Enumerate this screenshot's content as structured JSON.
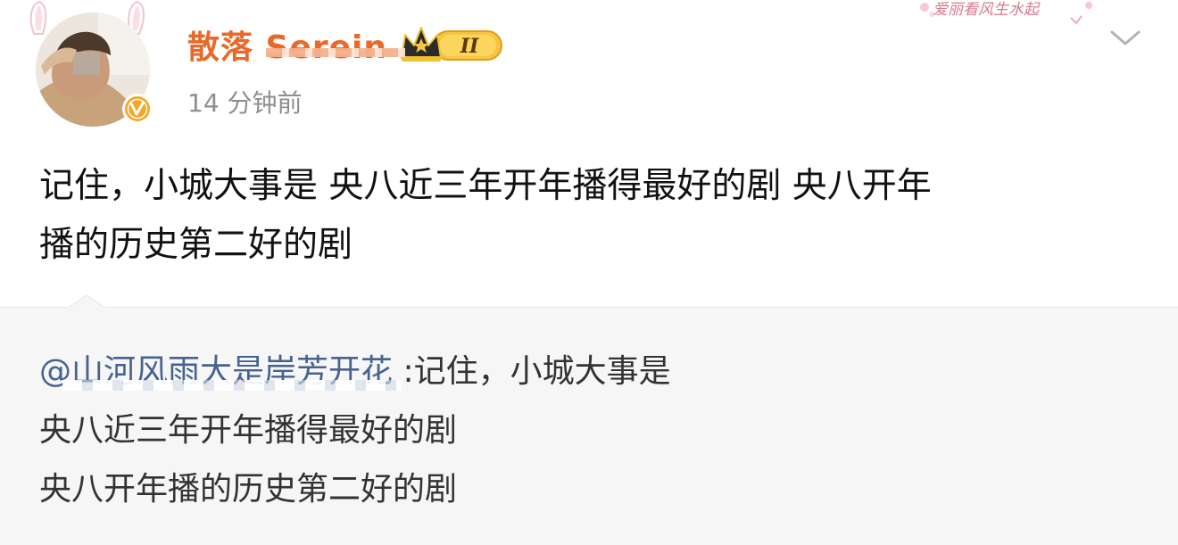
{
  "post": {
    "author": {
      "name": "散落 Serein",
      "level_badge": "II",
      "verified": true
    },
    "timestamp": "14 分钟前",
    "card_decoration_text": "爱丽看风生水起",
    "text_lines": [
      "记住，小城大事是 央八近三年开年播得最好的剧 央八开年",
      "播的历史第二好的剧"
    ]
  },
  "repost": {
    "mention": "@山河风雨大是岸芳开花",
    "first_line_rest": ":记住，小城大事是",
    "lines": [
      "央八近三年开年播得最好的剧",
      "央八开年播的历史第二好的剧"
    ]
  },
  "colors": {
    "username": "#e8692a",
    "mention": "#46638f",
    "timestamp": "#8e8e8e",
    "repost_bg": "#f6f6f6"
  },
  "icons": {
    "verified_badge": "verified-v-icon",
    "level_badge": "crown-level-icon",
    "more": "chevron-down-icon"
  }
}
